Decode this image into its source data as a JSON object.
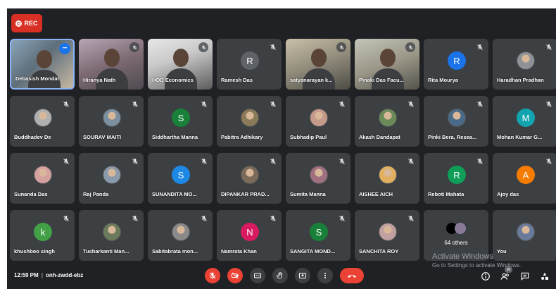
{
  "recording": {
    "label": "REC"
  },
  "meeting": {
    "time": "12:59 PM",
    "code": "onh-zwdd-ebz"
  },
  "participants": [
    {
      "name": "Debasish Mondal",
      "type": "video",
      "v": "v1",
      "pinned_menu": true
    },
    {
      "name": "Hiranya Nath",
      "type": "video",
      "v": "v2"
    },
    {
      "name": "HOD Economics",
      "type": "video",
      "v": "v3"
    },
    {
      "name": "Ramesh Das",
      "type": "letter",
      "letter": "R",
      "color": "#5f6368"
    },
    {
      "name": "satyanarayan k...",
      "type": "video",
      "v": "v4"
    },
    {
      "name": "Pinaki Das Facu...",
      "type": "video",
      "v": "v5"
    },
    {
      "name": "Rita Mourya",
      "type": "letter",
      "letter": "R",
      "color": "#1a73e8"
    },
    {
      "name": "Haradhan Pradhan",
      "type": "photo",
      "color": "#8e9296"
    },
    {
      "name": "Buddhadev De",
      "type": "photo",
      "color": "#b0b0b0"
    },
    {
      "name": "SOURAV MAITI",
      "type": "photo",
      "color": "#7a8fa0"
    },
    {
      "name": "Siddhartha Manna",
      "type": "letter",
      "letter": "S",
      "color": "#188038"
    },
    {
      "name": "Pabitra Adhikary",
      "type": "photo",
      "color": "#8a7a5a"
    },
    {
      "name": "Subhadip Paul",
      "type": "photo",
      "color": "#c49a8a"
    },
    {
      "name": "Akash Dandapat",
      "type": "photo",
      "color": "#6a8a5a"
    },
    {
      "name": "Pinki Bera, Resea...",
      "type": "photo",
      "color": "#4a6a8a"
    },
    {
      "name": "Mohan Kumar G...",
      "type": "letter",
      "letter": "M",
      "color": "#12a4af"
    },
    {
      "name": "Sunanda Das",
      "type": "photo",
      "color": "#d4a0a0"
    },
    {
      "name": "Raj Panda",
      "type": "photo",
      "color": "#8a9aaa"
    },
    {
      "name": "SUNANDITA MO...",
      "type": "letter",
      "letter": "S",
      "color": "#1e88e5"
    },
    {
      "name": "DIPANKAR PRAD...",
      "type": "photo",
      "color": "#7a6a5a"
    },
    {
      "name": "Sumita Manna",
      "type": "photo",
      "color": "#a07080"
    },
    {
      "name": "AISHEE AICH",
      "type": "photo",
      "color": "#e0b060"
    },
    {
      "name": "Reboti Mahata",
      "type": "letter",
      "letter": "R",
      "color": "#0f9d58"
    },
    {
      "name": "Ajoy das",
      "type": "letter",
      "letter": "A",
      "color": "#f57c00"
    },
    {
      "name": "khushboo singh",
      "type": "letter",
      "letter": "k",
      "color": "#43a047"
    },
    {
      "name": "Tusharkanti Man...",
      "type": "photo",
      "color": "#6a7a5a"
    },
    {
      "name": "Sabitabrata mon...",
      "type": "photo",
      "color": "#8a8a8a"
    },
    {
      "name": "Namrata Khan",
      "type": "letter",
      "letter": "N",
      "color": "#d81b60"
    },
    {
      "name": "SANGITA MOND...",
      "type": "letter",
      "letter": "S",
      "color": "#188038"
    },
    {
      "name": "SANCHITA ROY",
      "type": "photo",
      "color": "#c0a0a0"
    },
    {
      "name": "64 others",
      "type": "others"
    },
    {
      "name": "You",
      "type": "photo",
      "color": "#6a7a9a",
      "no_mute": true
    }
  ],
  "controls": {
    "mic_label": "Microphone off",
    "cam_label": "Camera off",
    "cc_label": "Captions",
    "hand_label": "Raise hand",
    "present_label": "Present now",
    "more_label": "More options",
    "leave_label": "Leave call"
  },
  "right_panel": {
    "people_count": "96"
  },
  "watermark": {
    "line1": "Activate Windows",
    "line2": "Go to Settings to activate Windows."
  }
}
